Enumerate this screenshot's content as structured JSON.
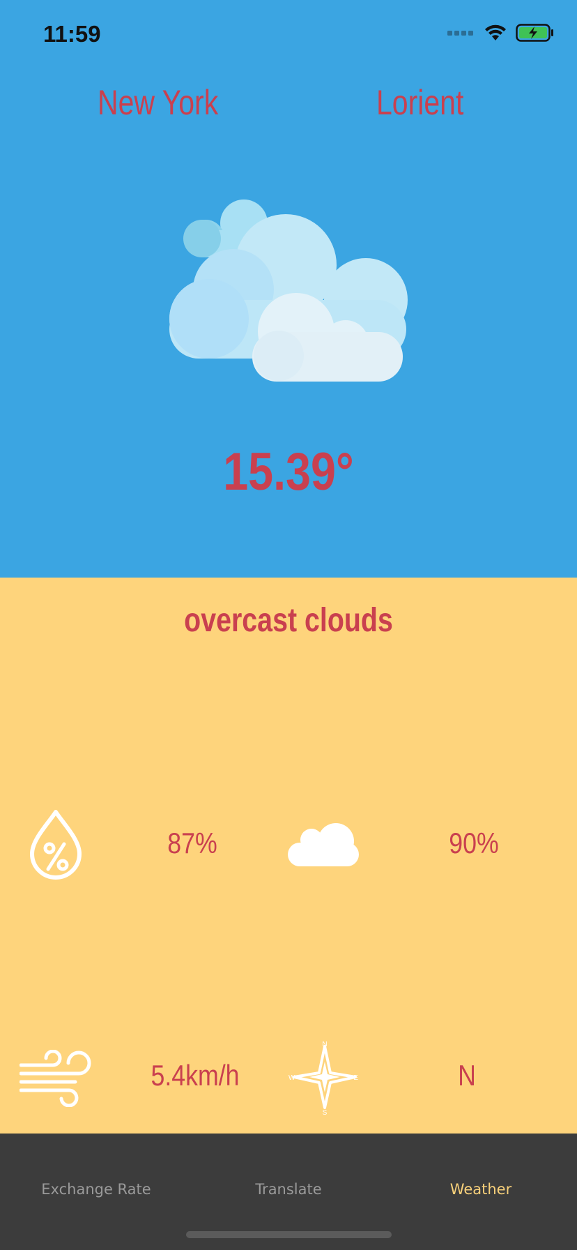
{
  "status_bar": {
    "time": "11:59"
  },
  "header": {
    "city_left": "New York",
    "city_right": "Lorient"
  },
  "weather": {
    "icon": "overcast-clouds-illustration",
    "temperature": "15.39°",
    "description": "overcast clouds",
    "humidity": "87%",
    "cloudiness": "90%",
    "wind_speed": "5.4km/h",
    "wind_direction": "N",
    "compass_labels": {
      "n": "N",
      "e": "E",
      "s": "S",
      "w": "W"
    }
  },
  "colors": {
    "sky": "#3ba5e2",
    "panel": "#fed47c",
    "accent_text": "#c9404f",
    "tabbar": "#3c3c3c",
    "tab_active": "#f7d07a"
  },
  "tabs": [
    {
      "label": "Exchange Rate",
      "active": false
    },
    {
      "label": "Translate",
      "active": false
    },
    {
      "label": "Weather",
      "active": true
    }
  ]
}
